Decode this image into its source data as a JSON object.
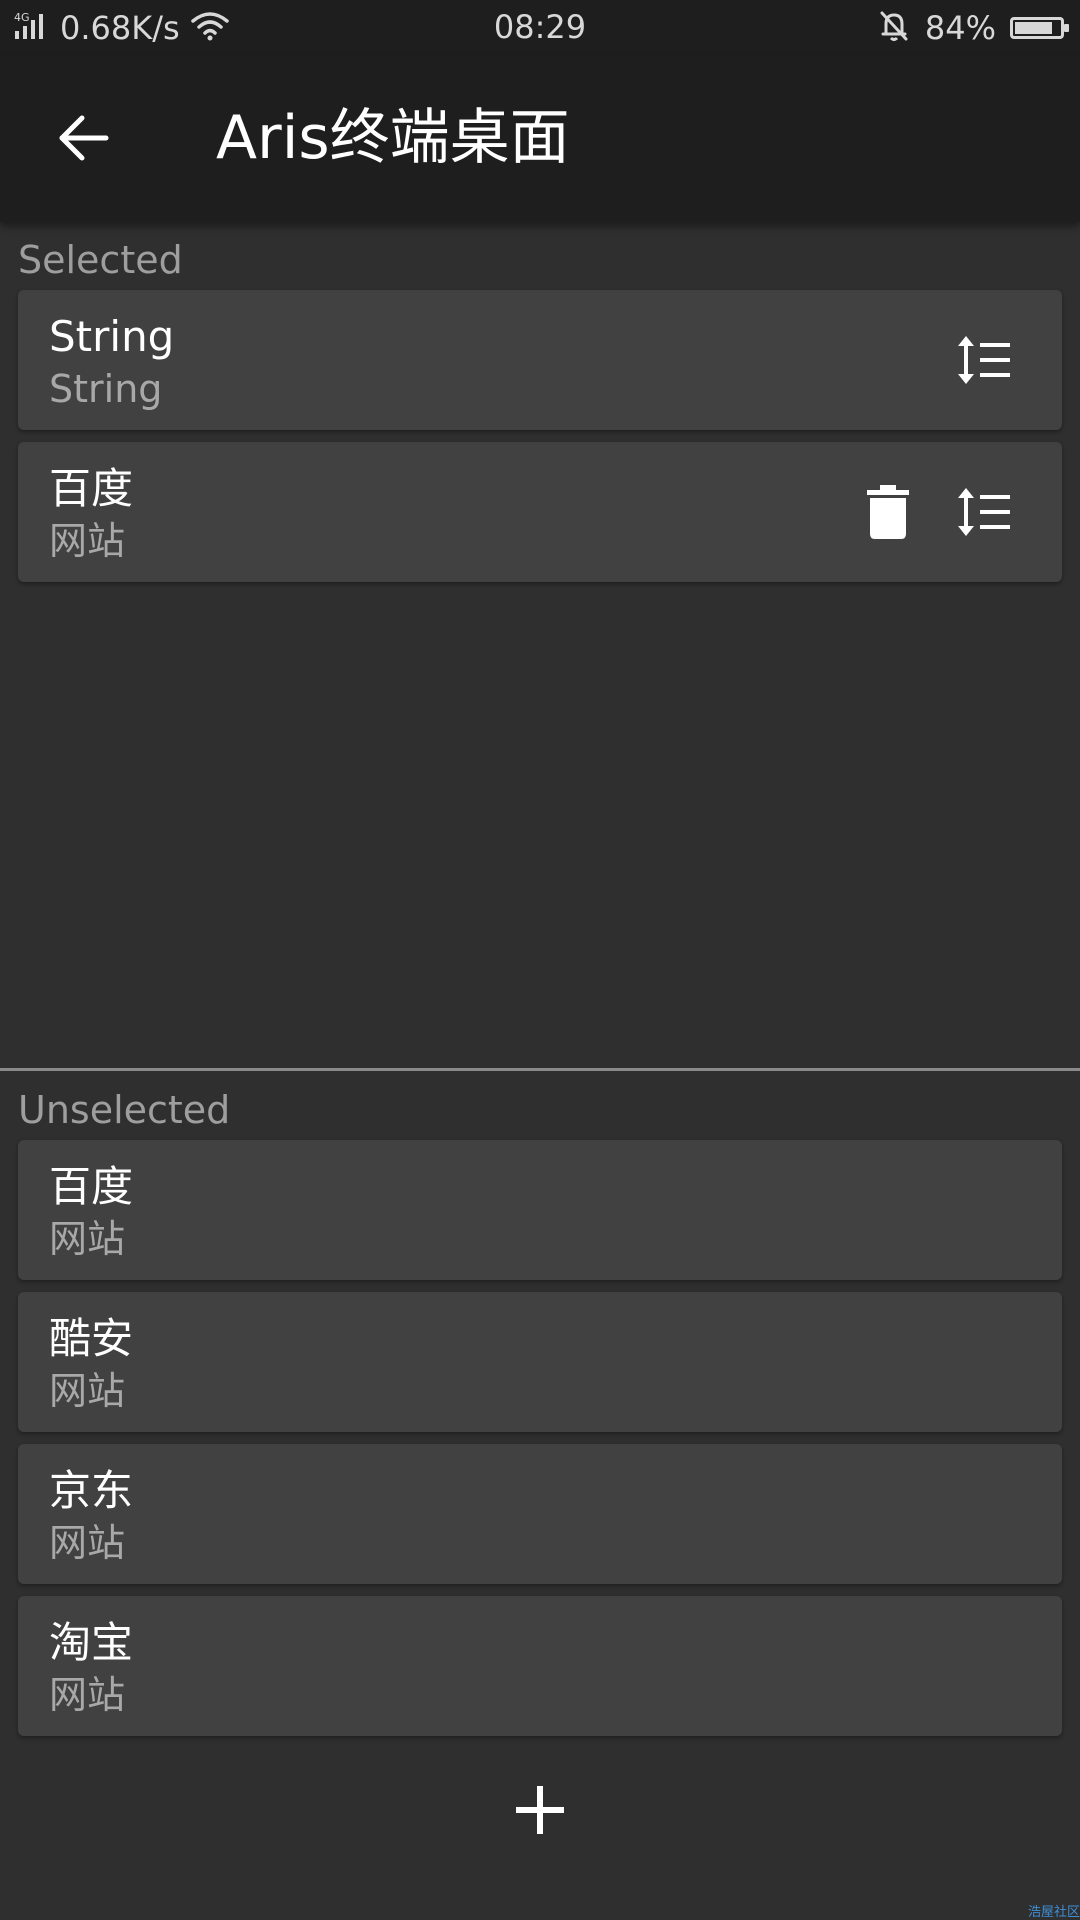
{
  "status_bar": {
    "network_type": "4G",
    "net_speed": "0.68K/s",
    "time": "08:29",
    "battery_text": "84%",
    "battery_level": 0.84,
    "icons": [
      "signal-icon",
      "wifi-icon",
      "bell-muted-icon",
      "battery-icon"
    ]
  },
  "app_bar": {
    "title": "Aris终端桌面",
    "back_icon": "arrow-back-icon"
  },
  "selected": {
    "label": "Selected",
    "items": [
      {
        "title": "String",
        "subtitle": "String",
        "actions": [
          "reorder-icon"
        ]
      },
      {
        "title": "百度",
        "subtitle": "网站",
        "actions": [
          "delete-icon",
          "reorder-icon"
        ]
      }
    ]
  },
  "unselected": {
    "label": "Unselected",
    "items": [
      {
        "title": "百度",
        "subtitle": "网站"
      },
      {
        "title": "酷安",
        "subtitle": "网站"
      },
      {
        "title": "京东",
        "subtitle": "网站"
      },
      {
        "title": "淘宝",
        "subtitle": "网站"
      }
    ]
  },
  "fab": {
    "icon": "plus-icon"
  },
  "watermark": "浩屋社区",
  "colors": {
    "background": "#2f2f2f",
    "app_bar": "#1e1e1e",
    "card": "#414141",
    "secondary_text": "#a8a8a8",
    "watermark": "#3f8fd6"
  }
}
